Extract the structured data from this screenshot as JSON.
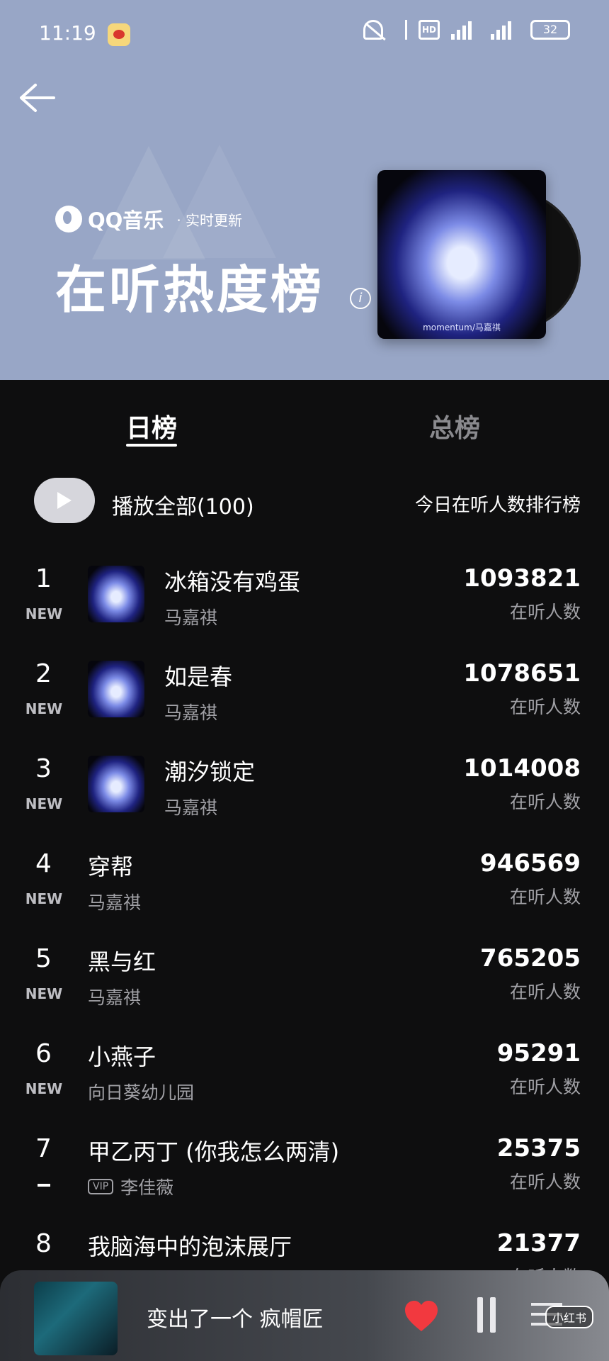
{
  "status_bar": {
    "time": "11:19",
    "hd": "HD",
    "battery": "32"
  },
  "header": {
    "brand": "QQ音乐",
    "tag": "· 实时更新",
    "title": "在听热度榜",
    "info": "i",
    "cover_caption": "momentum/马嘉祺"
  },
  "tabs": [
    {
      "label": "日榜",
      "active": true
    },
    {
      "label": "总榜",
      "active": false
    }
  ],
  "play_all": {
    "label": "播放全部(100)",
    "subtitle": "今日在听人数排行榜"
  },
  "songs": [
    {
      "rank": "1",
      "badge": "NEW",
      "title": "冰箱没有鸡蛋",
      "artist": "马嘉祺",
      "count": "1093821",
      "count_label": "在听人数",
      "thumb": true
    },
    {
      "rank": "2",
      "badge": "NEW",
      "title": "如是春",
      "artist": "马嘉祺",
      "count": "1078651",
      "count_label": "在听人数",
      "thumb": true
    },
    {
      "rank": "3",
      "badge": "NEW",
      "title": "潮汐锁定",
      "artist": "马嘉祺",
      "count": "1014008",
      "count_label": "在听人数",
      "thumb": true
    },
    {
      "rank": "4",
      "badge": "NEW",
      "title": "穿帮",
      "artist": "马嘉祺",
      "count": "946569",
      "count_label": "在听人数"
    },
    {
      "rank": "5",
      "badge": "NEW",
      "title": "黑与红",
      "artist": "马嘉祺",
      "count": "765205",
      "count_label": "在听人数"
    },
    {
      "rank": "6",
      "badge": "NEW",
      "title": "小燕子",
      "artist": "向日葵幼儿园",
      "count": "95291",
      "count_label": "在听人数"
    },
    {
      "rank": "7",
      "badge": "-",
      "title": "甲乙丙丁 (你我怎么两清)",
      "artist": "李佳薇",
      "vip": "VIP",
      "count": "25375",
      "count_label": "在听人数"
    },
    {
      "rank": "8",
      "badge": "",
      "title": "我脑海中的泡沫展厅",
      "artist": "",
      "count": "21377",
      "count_label": "在听人数"
    }
  ],
  "player": {
    "title": "变出了一个 疯帽匠",
    "watermark": "小红书"
  },
  "colors": {
    "header_bg": "#98a6c6",
    "page_bg": "#0e0e0f",
    "heart": "#f2393f"
  }
}
